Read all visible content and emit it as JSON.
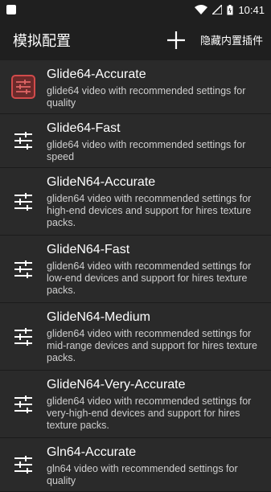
{
  "status": {
    "time": "10:41"
  },
  "appbar": {
    "title": "模拟配置",
    "hide_builtin": "隐藏内置插件"
  },
  "items": [
    {
      "name": "Glide64-Accurate",
      "desc": "glide64 video with recommended settings for quality"
    },
    {
      "name": "Glide64-Fast",
      "desc": "glide64 video with recommended settings for speed"
    },
    {
      "name": "GlideN64-Accurate",
      "desc": "gliden64 video with recommended settings for high-end devices and support for hires texture packs."
    },
    {
      "name": "GlideN64-Fast",
      "desc": "gliden64 video with recommended settings for low-end devices and support for hires texture packs."
    },
    {
      "name": "GlideN64-Medium",
      "desc": "gliden64 video with recommended settings for mid-range devices and support for hires texture packs."
    },
    {
      "name": "GlideN64-Very-Accurate",
      "desc": "gliden64 video with recommended settings for very-high-end devices and support for hires texture packs."
    },
    {
      "name": "Gln64-Accurate",
      "desc": "gln64 video with recommended settings for quality"
    }
  ],
  "colors": {
    "background": "#2a2a2a",
    "bar": "#1f1f1f",
    "accent": "#d24b4b"
  }
}
